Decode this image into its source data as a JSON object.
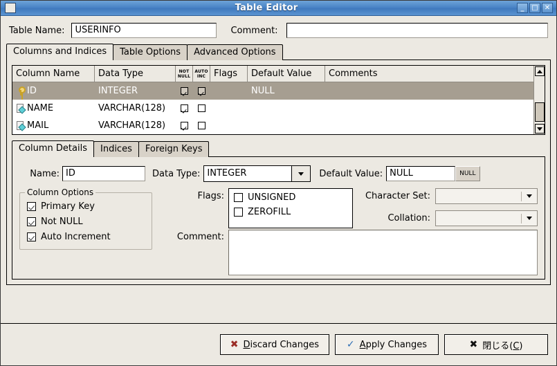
{
  "window": {
    "title": "Table Editor",
    "icon": "window-menu-icon",
    "buttons": [
      {
        "name": "minimize",
        "glyph": "_"
      },
      {
        "name": "maximize",
        "glyph": "□"
      },
      {
        "name": "close",
        "glyph": "✕"
      }
    ]
  },
  "header": {
    "table_name_label": "Table Name:",
    "table_name_value": "USERINFO",
    "table_name_placeholder": "",
    "comment_label": "Comment:",
    "comment_value": "",
    "comment_placeholder": ""
  },
  "main_tabs": [
    {
      "label": "Columns and Indices",
      "active": true
    },
    {
      "label": "Table Options",
      "active": false
    },
    {
      "label": "Advanced Options",
      "active": false
    }
  ],
  "grid": {
    "headers": {
      "column_name": "Column Name",
      "data_type": "Data Type",
      "not_null_line1": "NOT",
      "not_null_line2": "NULL",
      "auto_inc_line1": "AUTO",
      "auto_inc_line2": "INC",
      "flags": "Flags",
      "default_value": "Default Value",
      "comments": "Comments"
    },
    "rows": [
      {
        "icon": "primary-key-icon",
        "column_name": "ID",
        "data_type": "INTEGER",
        "not_null": true,
        "auto_inc": true,
        "flags": "",
        "default_value": "NULL",
        "comments": "",
        "selected": true
      },
      {
        "icon": "column-icon",
        "column_name": "NAME",
        "data_type": "VARCHAR(128)",
        "not_null": true,
        "auto_inc": false,
        "flags": "",
        "default_value": "",
        "comments": "",
        "selected": false
      },
      {
        "icon": "column-icon",
        "column_name": "MAIL",
        "data_type": "VARCHAR(128)",
        "not_null": true,
        "auto_inc": false,
        "flags": "",
        "default_value": "",
        "comments": "",
        "selected": false
      }
    ]
  },
  "detail_tabs": [
    {
      "label": "Column Details",
      "active": true
    },
    {
      "label": "Indices",
      "active": false
    },
    {
      "label": "Foreign Keys",
      "active": false
    }
  ],
  "column_details": {
    "name_label": "Name:",
    "name_value": "ID",
    "data_type_label": "Data Type:",
    "data_type_value": "INTEGER",
    "default_value_label": "Default Value:",
    "default_value_value": "NULL",
    "null_button_label": "NULL",
    "options_group_title": "Column Options",
    "options": [
      {
        "label": "Primary Key",
        "checked": true
      },
      {
        "label": "Not NULL",
        "checked": true
      },
      {
        "label": "Auto Increment",
        "checked": true
      }
    ],
    "flags_label": "Flags:",
    "flags": [
      {
        "label": "UNSIGNED",
        "checked": false
      },
      {
        "label": "ZEROFILL",
        "checked": false
      }
    ],
    "character_set_label": "Character Set:",
    "character_set_value": "",
    "collation_label": "Collation:",
    "collation_value": "",
    "comment_label": "Comment:",
    "comment_value": ""
  },
  "actions": {
    "discard": {
      "pre": "",
      "accel": "D",
      "post": "iscard Changes",
      "icon": "x-mark-red-icon"
    },
    "apply": {
      "pre": "",
      "accel": "A",
      "post": "pply Changes",
      "icon": "check-mark-blue-icon"
    },
    "close": {
      "pre": "閉じる(",
      "accel": "C",
      "post": ")",
      "icon": "x-mark-black-icon"
    }
  },
  "colors": {
    "titlebar": "#4a85c6",
    "window_bg": "#ece9e2",
    "selection": "#a69e91",
    "field_bg": "#ffffff"
  }
}
